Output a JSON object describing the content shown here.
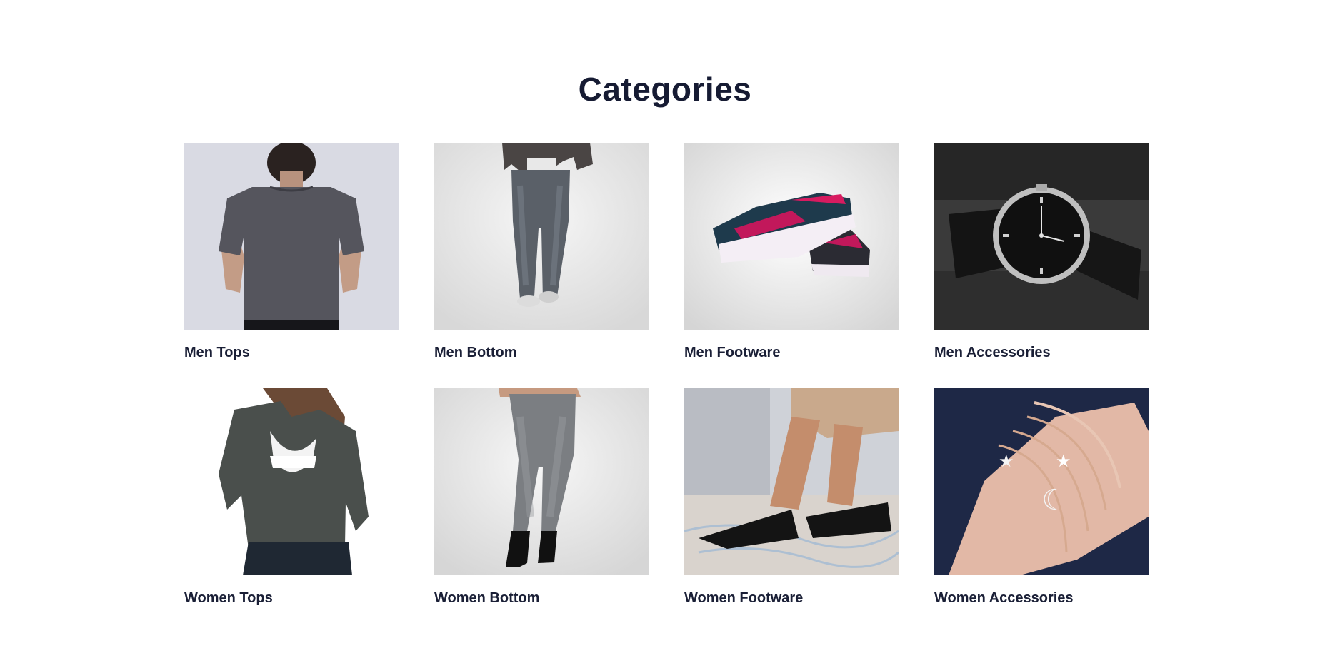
{
  "section": {
    "title": "Categories"
  },
  "categories": [
    {
      "label": "Men Tops",
      "image": "grey-tshirt-back-photo"
    },
    {
      "label": "Men Bottom",
      "image": "denim-jeans-photo"
    },
    {
      "label": "Men Footware",
      "image": "sneakers-photo"
    },
    {
      "label": "Men Accessories",
      "image": "wrist-watch-photo"
    },
    {
      "label": "Women Tops",
      "image": "open-back-sweater-photo"
    },
    {
      "label": "Women Bottom",
      "image": "grey-skinny-jeans-photo"
    },
    {
      "label": "Women Footware",
      "image": "strappy-sandals-photo"
    },
    {
      "label": "Women Accessories",
      "image": "bracelets-photo"
    }
  ],
  "colors": {
    "text": "#1a1f36",
    "background": "#ffffff"
  }
}
